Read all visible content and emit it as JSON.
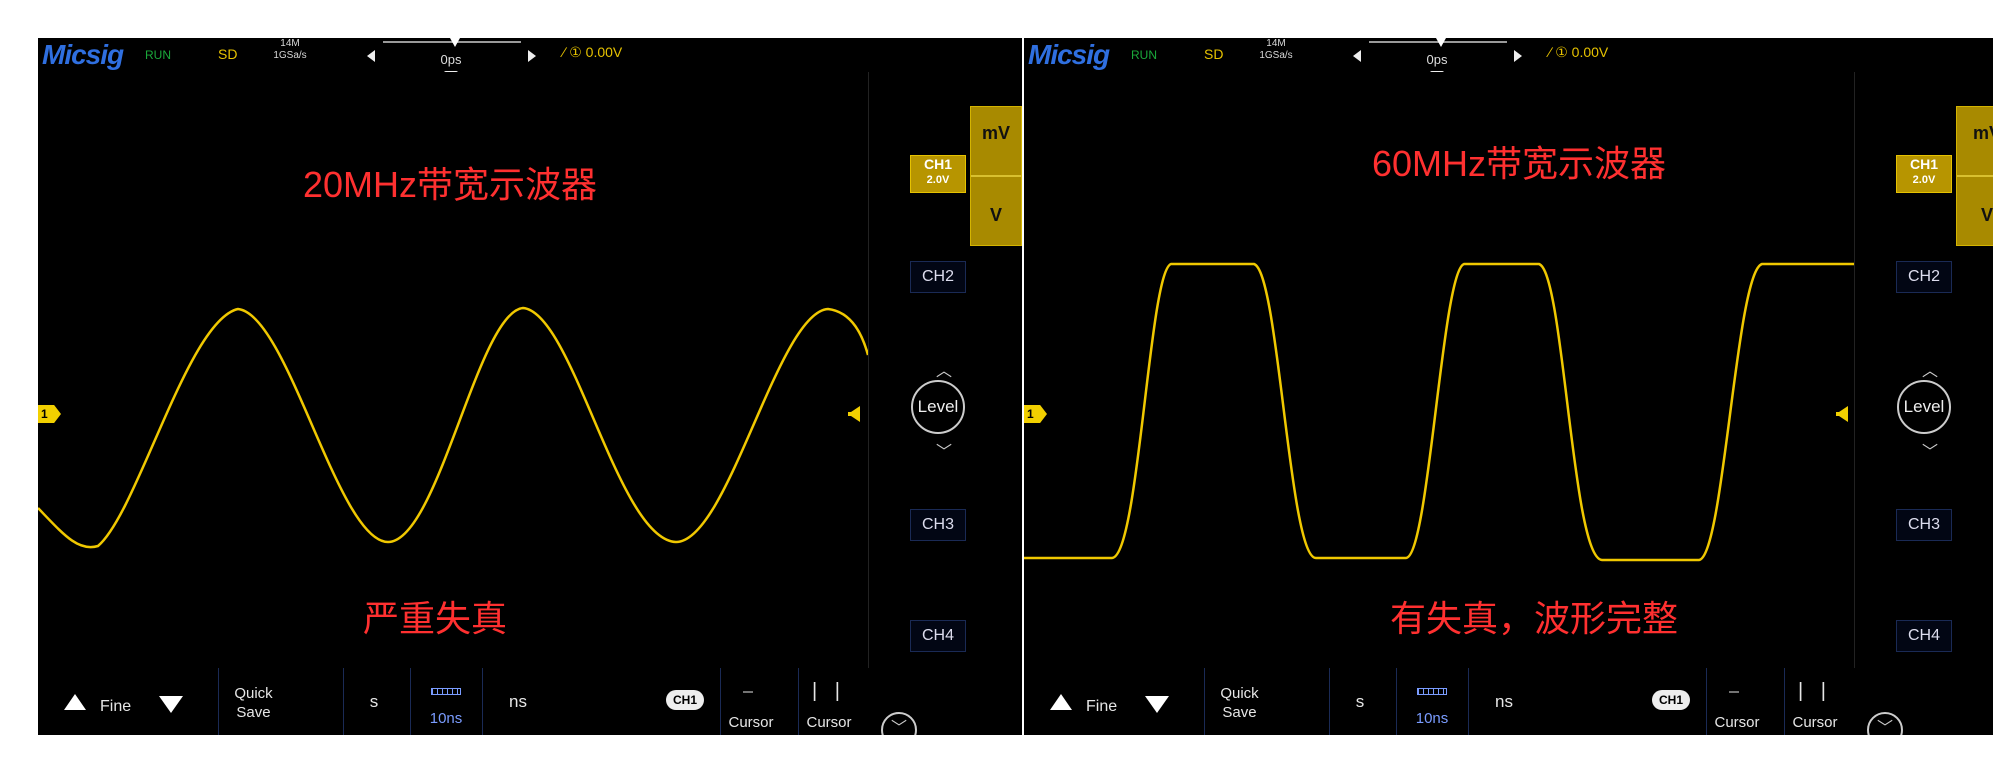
{
  "left": {
    "brand": "Micsig",
    "run_status": "RUN",
    "mode": "SD",
    "memory_depth": "14M",
    "sample_rate": "1GSa/s",
    "delay": "0ps",
    "trigger_marker": "T",
    "trigger_info": "∕ ① 0.00V",
    "overlay_title": "20MHz带宽示波器",
    "overlay_note": "严重失真",
    "channel_marker": "1",
    "volt_upper": "mV",
    "volt_lower": "V",
    "ch1_label": "CH1",
    "ch1_scale": "2.0V",
    "ch2_label": "CH2",
    "ch3_label": "CH3",
    "ch4_label": "CH4",
    "level_label": "Level",
    "fine_label": "Fine",
    "quick_save_1": "Quick",
    "quick_save_2": "Save",
    "unit_s": "s",
    "timebase": "10ns",
    "unit_ns": "ns",
    "ch1_pill": "CH1",
    "cursor_1": "Cursor",
    "cursor_2": "Cursor"
  },
  "right": {
    "brand": "Micsig",
    "run_status": "RUN",
    "mode": "SD",
    "memory_depth": "14M",
    "sample_rate": "1GSa/s",
    "delay": "0ps",
    "trigger_marker": "T",
    "trigger_info": "∕ ① 0.00V",
    "overlay_title": "60MHz带宽示波器",
    "overlay_note": "有失真，波形完整",
    "channel_marker": "1",
    "volt_upper": "mV",
    "volt_lower": "V",
    "ch1_label": "CH1",
    "ch1_scale": "2.0V",
    "ch2_label": "CH2",
    "ch3_label": "CH3",
    "ch4_label": "CH4",
    "level_label": "Level",
    "fine_label": "Fine",
    "quick_save_1": "Quick",
    "quick_save_2": "Save",
    "unit_s": "s",
    "timebase": "10ns",
    "unit_ns": "ns",
    "ch1_pill": "CH1",
    "cursor_1": "Cursor",
    "cursor_2": "Cursor"
  },
  "colors": {
    "trace": "#f0c800",
    "overlay_text": "#ff3030",
    "accent_yellow": "#e6c200"
  }
}
